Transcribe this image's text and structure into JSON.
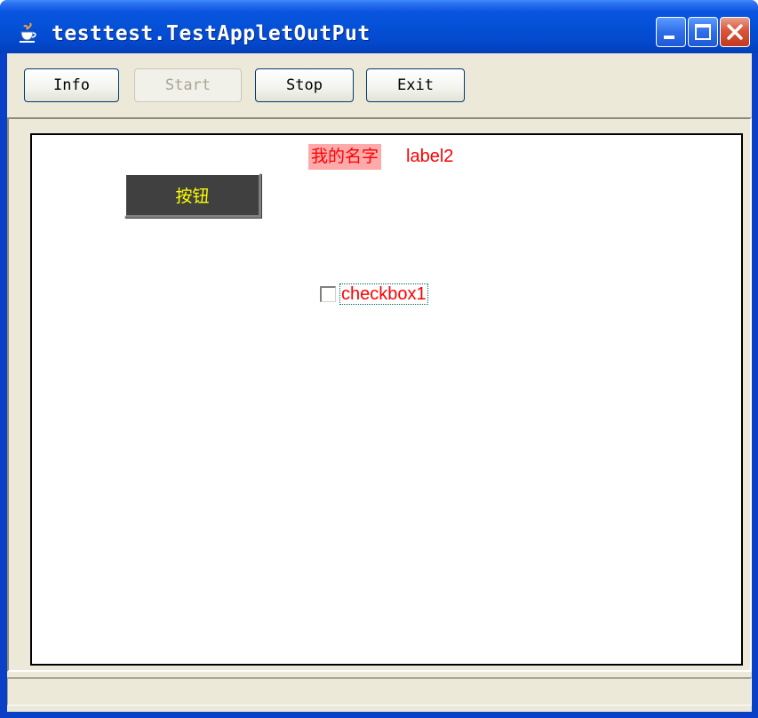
{
  "window": {
    "title": "testtest.TestAppletOutPut",
    "title_icon": "java-cup-icon",
    "controls": [
      "minimize-icon",
      "maximize-icon",
      "close-icon"
    ]
  },
  "toolbar": {
    "info_label": "Info",
    "start_label": "Start",
    "start_disabled": true,
    "stop_label": "Stop",
    "exit_label": "Exit"
  },
  "applet": {
    "label1": "我的名字",
    "label1_bg": "#ffaaaa",
    "label1_color": "#ff0000",
    "label2": "label2",
    "label2_color": "#ff0000",
    "button_label": "按钮",
    "button_bg": "#404040",
    "button_color": "#ffff00",
    "checkbox_label": "checkbox1",
    "checkbox_checked": false,
    "checkbox_color": "#ff0000"
  },
  "status": {
    "text": ""
  }
}
